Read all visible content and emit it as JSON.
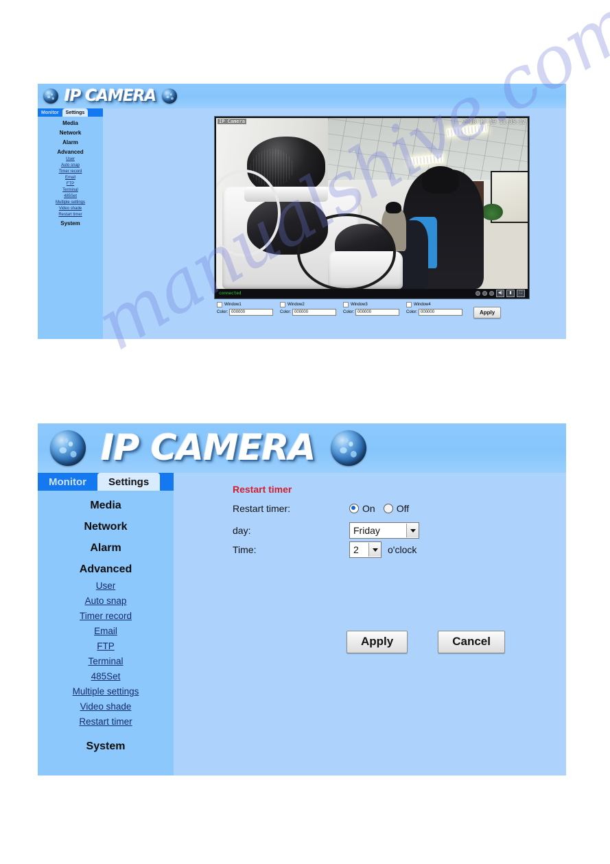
{
  "watermark": {
    "text": "manualshive.com",
    "color": "#6E78D7"
  },
  "theme": {
    "header_blue": "#8CC8FC",
    "sidebar_blue": "#8CC8FC",
    "content_blue": "#ADD3FD",
    "tabstrip_blue": "#1478F0",
    "title_red": "#D01E2E"
  },
  "brand": {
    "wordmark": "IP CAMERA",
    "globe_left": "globe-icon",
    "globe_right": "globe-icon"
  },
  "tabs": [
    {
      "label": "Monitor",
      "active": false
    },
    {
      "label": "Settings",
      "active": true
    }
  ],
  "sidebar": {
    "groups": [
      "Media",
      "Network",
      "Alarm",
      "Advanced"
    ],
    "links": [
      "User",
      "Auto snap",
      "Timer record",
      "Email",
      "FTP",
      "Terminal",
      "485Set",
      "Multiple settings",
      "Video shade",
      "Restart timer"
    ],
    "system": "System"
  },
  "monitor": {
    "video_label": "IP Camera",
    "timestamp": "2018-12-19 11:35:12",
    "status": "connected",
    "controls": [
      "zoom-icon",
      "focus-icon",
      "iris-icon",
      "speaker-icon",
      "microphone-icon",
      "fullscreen-icon"
    ],
    "windows": [
      {
        "name": "Window1",
        "color_label": "Color:",
        "color_value": "000000",
        "checked": false
      },
      {
        "name": "Window2",
        "color_label": "Color:",
        "color_value": "000000",
        "checked": false
      },
      {
        "name": "Window3",
        "color_label": "Color:",
        "color_value": "000000",
        "checked": false
      },
      {
        "name": "Window4",
        "color_label": "Color:",
        "color_value": "000000",
        "checked": false
      }
    ],
    "apply_label": "Apply"
  },
  "restart_timer": {
    "title": "Restart timer",
    "fields": {
      "enable_label": "Restart timer:",
      "on_label": "On",
      "off_label": "Off",
      "enabled": true,
      "day_label": "day:",
      "day_value": "Friday",
      "time_label": "Time:",
      "time_value": "2",
      "time_suffix": "o'clock"
    },
    "apply_label": "Apply",
    "cancel_label": "Cancel"
  }
}
